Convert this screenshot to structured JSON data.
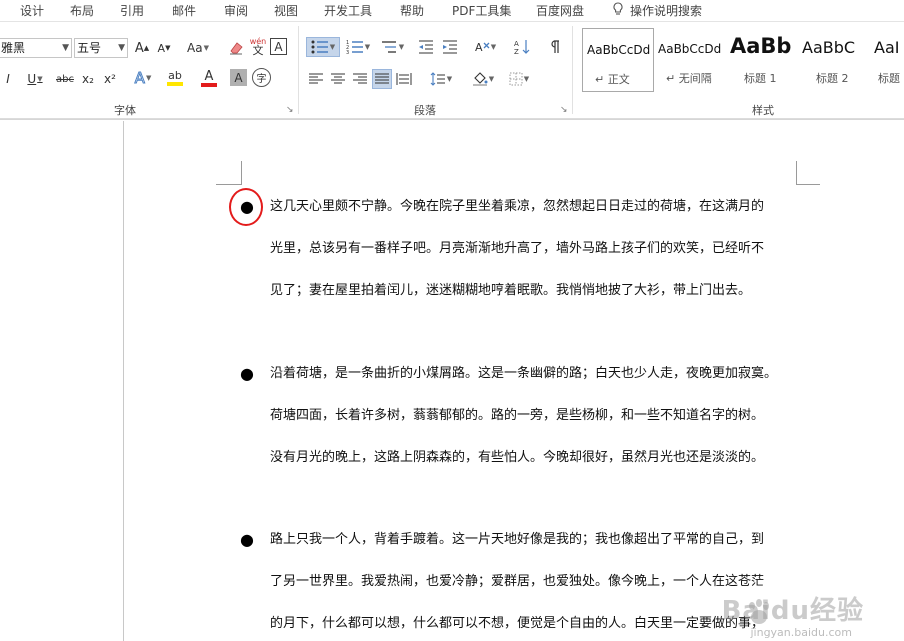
{
  "tabs": [
    "设计",
    "布局",
    "引用",
    "邮件",
    "审阅",
    "视图",
    "开发工具",
    "帮助",
    "PDF工具集",
    "百度网盘",
    "操作说明搜索"
  ],
  "ribbon": {
    "font_group": {
      "label": "字体",
      "font_name": "雅黑",
      "font_size": "五号",
      "grow_font": "A",
      "shrink_font": "A",
      "change_case": "Aa",
      "phonetic": "wén",
      "bold": "I",
      "underline": "U",
      "strike": "abc",
      "subscript": "x₂",
      "superscript": "x²",
      "text_effect": "A",
      "highlight": "ab",
      "font_color": "A",
      "char_shading": "A",
      "enclose": "字"
    },
    "paragraph_group": {
      "label": "段落"
    },
    "styles_group": {
      "label": "样式",
      "items": [
        {
          "sample": "AaBbCcDd",
          "name": "正文"
        },
        {
          "sample": "AaBbCcDd",
          "name": "无间隔"
        },
        {
          "sample": "AaBb",
          "name": "标题 1"
        },
        {
          "sample": "AaBbC",
          "name": "标题 2"
        },
        {
          "sample": "AaI",
          "name": "标题"
        }
      ]
    }
  },
  "document": {
    "paragraphs": [
      {
        "lines": [
          "这几天心里颇不宁静。今晚在院子里坐着乘凉，忽然想起日日走过的荷塘，在这满月的",
          "光里，总该另有一番样子吧。月亮渐渐地升高了，墙外马路上孩子们的欢笑，已经听不",
          "见了；妻在屋里拍着闰儿，迷迷糊糊地哼着眠歌。我悄悄地披了大衫，带上门出去。"
        ]
      },
      {
        "lines": [
          "沿着荷塘，是一条曲折的小煤屑路。这是一条幽僻的路；白天也少人走，夜晚更加寂寞。",
          "荷塘四面，长着许多树，蓊蓊郁郁的。路的一旁，是些杨柳，和一些不知道名字的树。",
          "没有月光的晚上，这路上阴森森的，有些怕人。今晚却很好，虽然月光也还是淡淡的。"
        ]
      },
      {
        "lines": [
          "路上只我一个人，背着手踱着。这一片天地好像是我的；我也像超出了平常的自己，到",
          "了另一世界里。我爱热闹，也爱冷静；爱群居，也爱独处。像今晚上，一个人在这苍茫",
          "的月下，什么都可以想，什么都可以不想，便觉是个自由的人。白天里一定要做的事，"
        ]
      }
    ],
    "bullet_char": "●"
  },
  "watermark": {
    "title": "Baidu经验",
    "sub": "jingyan.baidu.com"
  },
  "colors": {
    "accent_ring": "#e31b1b",
    "font_color_bar": "#e31b1b",
    "highlight_bar": "#ffe600",
    "active_btn": "#c5d5ea"
  }
}
